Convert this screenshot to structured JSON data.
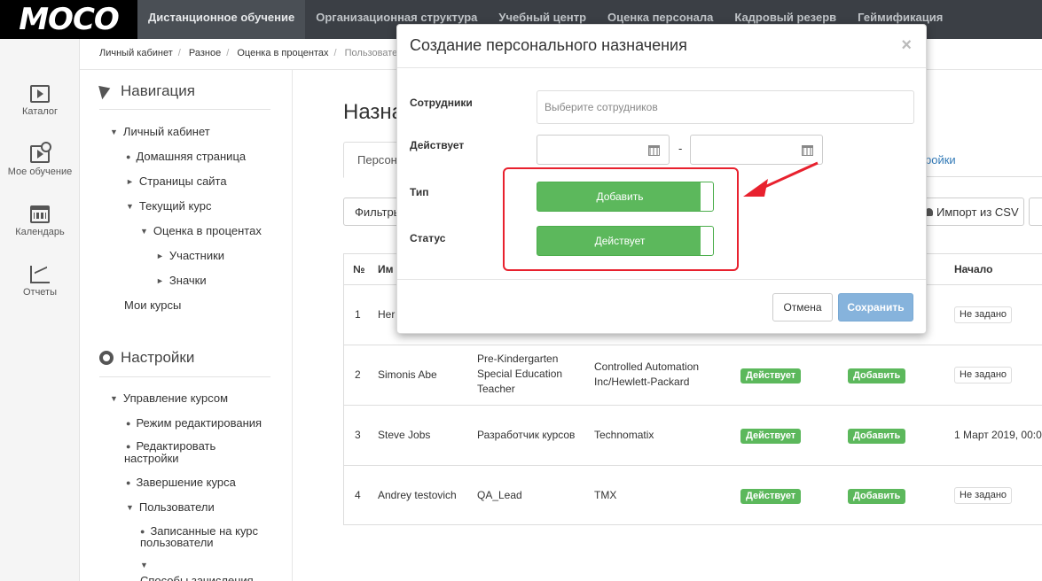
{
  "app": {
    "logo": "MOCO"
  },
  "topnav": [
    "Дистанционное обучение",
    "Организационная структура",
    "Учебный центр",
    "Оценка персонала",
    "Кадровый резерв",
    "Геймификация"
  ],
  "iconbar": [
    {
      "label": "Каталог",
      "icon": "play-monitor-icon"
    },
    {
      "label": "Мое обучение",
      "icon": "learning-icon"
    },
    {
      "label": "Календарь",
      "icon": "calendar-icon"
    },
    {
      "label": "Отчеты",
      "icon": "chart-icon"
    }
  ],
  "breadcrumb": [
    "Личный кабинет",
    "Разное",
    "Оценка в процентах",
    "Пользовател"
  ],
  "navigation": {
    "title": "Навигация",
    "items": [
      "Личный кабинет",
      "Домашняя страница",
      "Страницы сайта",
      "Текущий курс",
      "Оценка в процентах",
      "Участники",
      "Значки",
      "Мои курсы"
    ]
  },
  "settings": {
    "title": "Настройки",
    "items": [
      "Управление курсом",
      "Режим редактирования",
      "Редактировать",
      "настройки",
      "Завершение курса",
      "Пользователи",
      "Записанные на курс",
      "пользователи",
      "Способы зачисления"
    ]
  },
  "main": {
    "title": "Назна",
    "tab_active": "Персона",
    "tab_right": "ройки",
    "filter_btn": "Фильтры",
    "import_btn": "Импорт из CSV"
  },
  "table": {
    "headers": {
      "num": "№",
      "name": "Им",
      "start": "Начало"
    },
    "rows": [
      {
        "num": "1",
        "name": "Her",
        "position": "",
        "company": "",
        "status": "",
        "type": "",
        "start": "Не задано"
      },
      {
        "num": "2",
        "name": "Simonis Abe",
        "position": [
          "Pre-Kindergarten",
          "Special Education",
          "Teacher"
        ],
        "company": [
          "Controlled Automation",
          "Inc/Hewlett-Packard"
        ],
        "status": "Действует",
        "type": "Добавить",
        "start": "Не задано"
      },
      {
        "num": "3",
        "name": "Steve Jobs",
        "position": [
          "Разработчик курсов"
        ],
        "company": [
          "Technomatix"
        ],
        "status": "Действует",
        "type": "Добавить",
        "start": "1 Март 2019, 00:0"
      },
      {
        "num": "4",
        "name": "Andrey testovich",
        "position": [
          "QA_Lead"
        ],
        "company": [
          "TMX"
        ],
        "status": "Действует",
        "type": "Добавить",
        "start": "Не задано"
      }
    ]
  },
  "modal": {
    "title": "Создание персонального назначения",
    "close": "×",
    "employees_label": "Сотрудники",
    "employees_placeholder": "Выберите сотрудников",
    "valid_label": "Действует",
    "date_sep": "-",
    "type_label": "Тип",
    "type_value": "Добавить",
    "status_label": "Статус",
    "status_value": "Действует",
    "cancel": "Отмена",
    "save": "Сохранить"
  },
  "colors": {
    "green": "#5cb85c",
    "save": "#86b3dc",
    "annotation": "#e8212e",
    "topbar": "#3b3f45"
  }
}
